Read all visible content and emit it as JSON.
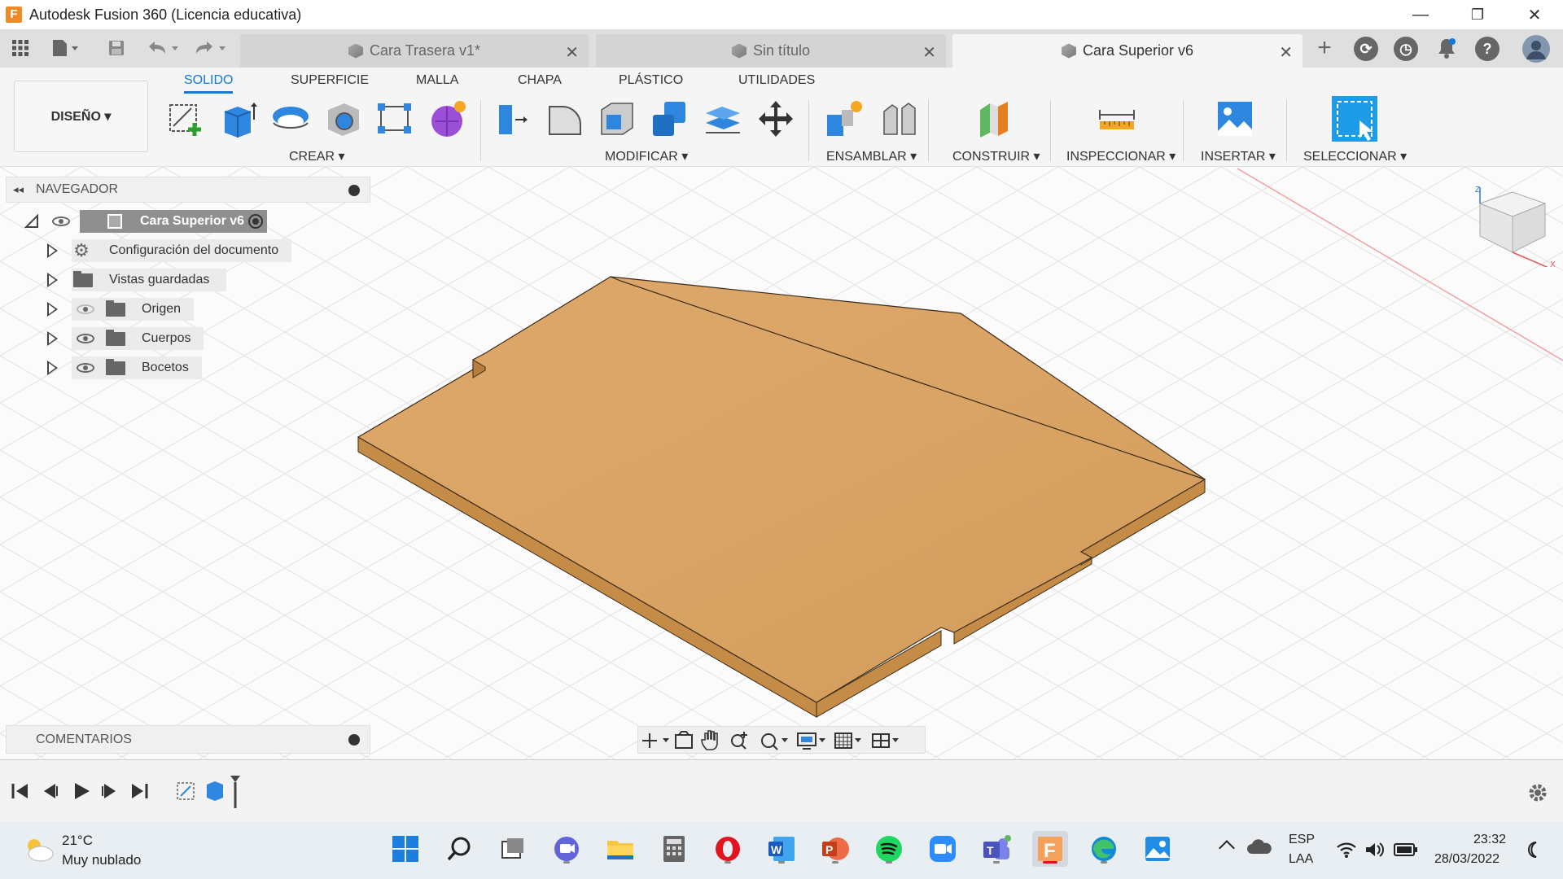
{
  "window": {
    "app_logo_letter": "F",
    "title": "Autodesk Fusion 360 (Licencia educativa)",
    "minimize": "—",
    "restore": "❐",
    "close": "✕"
  },
  "tabs": [
    {
      "label": "Cara Trasera v1*",
      "close": "✕",
      "active": false
    },
    {
      "label": "Sin título",
      "close": "✕",
      "active": false
    },
    {
      "label": "Cara Superior v6",
      "close": "✕",
      "active": true
    }
  ],
  "tabbar": {
    "new_tab": "+"
  },
  "ribbon": {
    "workspace": "DISEÑO ▾",
    "tabs": [
      "SOLIDO",
      "SUPERFICIE",
      "MALLA",
      "CHAPA",
      "PLÁSTICO",
      "UTILIDADES"
    ],
    "groups": [
      "CREAR ▾",
      "MODIFICAR ▾",
      "ENSAMBLAR ▾",
      "CONSTRUIR ▾",
      "INSPECCIONAR ▾",
      "INSERTAR ▾",
      "SELECCIONAR ▾"
    ]
  },
  "navigator": {
    "collapse": "◂◂",
    "title": "NAVEGADOR",
    "root": "Cara Superior v6",
    "items": [
      {
        "label": "Configuración del documento",
        "icon": "gear-icon"
      },
      {
        "label": "Vistas guardadas",
        "icon": "folder-icon"
      },
      {
        "label": "Origen",
        "icon": "folder-icon",
        "visibility": "hidden"
      },
      {
        "label": "Cuerpos",
        "icon": "folder-icon",
        "visibility": "visible"
      },
      {
        "label": "Bocetos",
        "icon": "folder-icon",
        "visibility": "visible"
      }
    ]
  },
  "comments": {
    "title": "COMENTARIOS"
  },
  "viewcube": {
    "axis_z": "Z",
    "axis_x": "X"
  },
  "taskbar": {
    "weather_temp": "21°C",
    "weather_desc": "Muy nublado",
    "lang_1": "ESP",
    "lang_2": "LAA",
    "time": "23:32",
    "date": "28/03/2022"
  },
  "colors": {
    "accent": "#1279d8",
    "wood": "#d9a465",
    "wood_edge": "#c58c48"
  }
}
